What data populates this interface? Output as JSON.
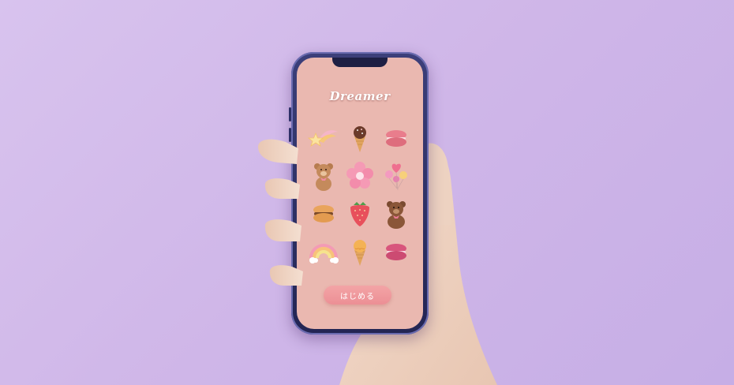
{
  "app": {
    "title": "Dreamer",
    "start_button_label": "はじめる"
  },
  "stickers": [
    {
      "icon": "shooting-star-icon"
    },
    {
      "icon": "chocolate-ice-cream-icon"
    },
    {
      "icon": "pink-macaron-icon"
    },
    {
      "icon": "teddy-bear-icon"
    },
    {
      "icon": "pink-flower-icon"
    },
    {
      "icon": "heart-balloons-icon"
    },
    {
      "icon": "yellow-macaron-icon"
    },
    {
      "icon": "strawberry-icon"
    },
    {
      "icon": "brown-bear-icon"
    },
    {
      "icon": "rainbow-icon"
    },
    {
      "icon": "orange-ice-cream-icon"
    },
    {
      "icon": "magenta-macaron-icon"
    }
  ],
  "colors": {
    "background": "#cfb6e8",
    "screen": "#eab8b0",
    "button": "#ec8f95",
    "phone_frame": "#2d2f66"
  }
}
